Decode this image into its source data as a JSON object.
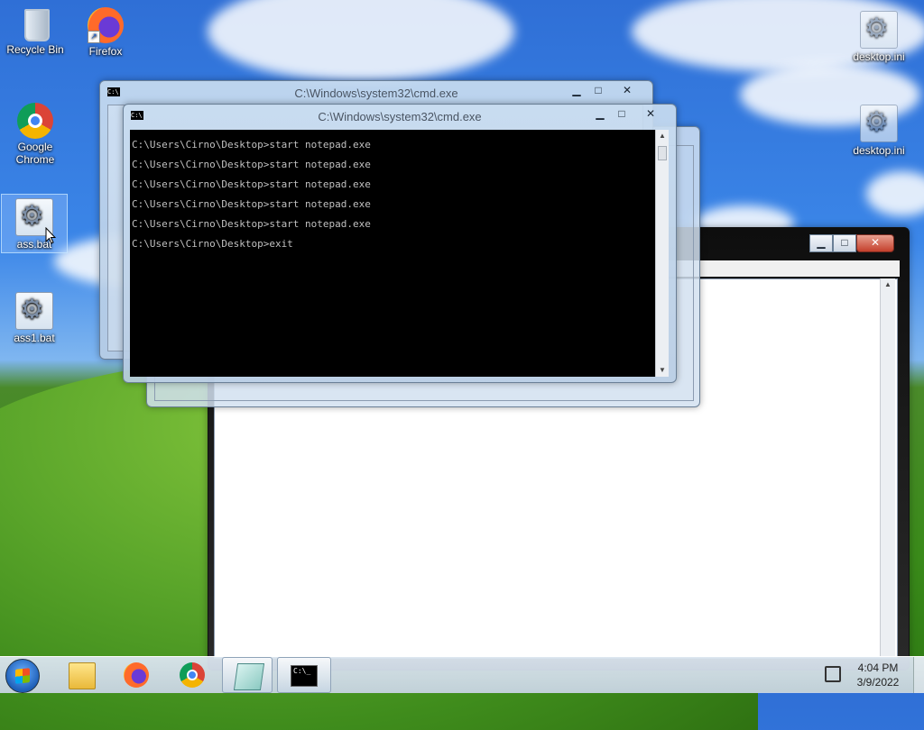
{
  "desktop": {
    "icons_left": [
      {
        "label": "Recycle Bin",
        "icon": "recycle-bin-icon"
      },
      {
        "label": "Firefox",
        "icon": "firefox-icon"
      },
      {
        "label": "Google Chrome",
        "icon": "chrome-icon"
      },
      {
        "label": "ass.bat",
        "icon": "batch-file-icon"
      },
      {
        "label": "ass1.bat",
        "icon": "batch-file-icon"
      }
    ],
    "icons_right": [
      {
        "label": "desktop.ini",
        "icon": "settings-file-icon"
      },
      {
        "label": "desktop.ini",
        "icon": "settings-file-icon"
      }
    ]
  },
  "windows": {
    "cmd_back": {
      "title": "C:\\Windows\\system32\\cmd.exe"
    },
    "cmd_front": {
      "title": "C:\\Windows\\system32\\cmd.exe"
    },
    "console_lines": [
      "C:\\Users\\Cirno\\Desktop>start notepad.exe",
      "C:\\Users\\Cirno\\Desktop>start notepad.exe",
      "C:\\Users\\Cirno\\Desktop>start notepad.exe",
      "C:\\Users\\Cirno\\Desktop>start notepad.exe",
      "C:\\Users\\Cirno\\Desktop>start notepad.exe",
      "C:\\Users\\Cirno\\Desktop>exit"
    ],
    "controls": {
      "minimize": "▁",
      "maximize": "□",
      "close": "✕"
    }
  },
  "taskbar": {
    "items": [
      "start-orb",
      "file-explorer-icon",
      "firefox-icon",
      "chrome-icon",
      "notepad-icon",
      "cmd-icon"
    ],
    "cmd_icon_text": "C:\\_",
    "clock": {
      "time": "4:04 PM",
      "date": "3/9/2022"
    }
  },
  "colors": {
    "console_bg": "#000000",
    "console_text": "#c0c0c0",
    "close_button": "#c4402c"
  }
}
